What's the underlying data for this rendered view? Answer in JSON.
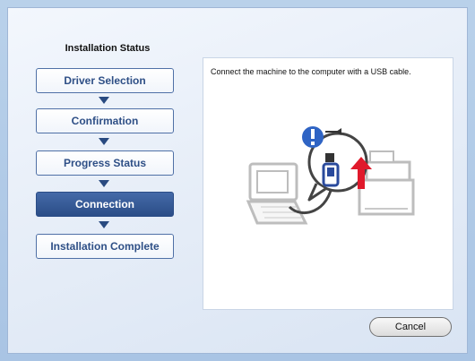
{
  "sidebar": {
    "title": "Installation Status",
    "steps": [
      {
        "label": "Driver Selection",
        "state": "inactive"
      },
      {
        "label": "Confirmation",
        "state": "inactive"
      },
      {
        "label": "Progress Status",
        "state": "inactive"
      },
      {
        "label": "Connection",
        "state": "active"
      },
      {
        "label": "Installation Complete",
        "state": "inactive"
      }
    ]
  },
  "main": {
    "message": "Connect the machine to the computer with a USB cable.",
    "illustration_icons": [
      "alert-icon",
      "usb-icon",
      "up-arrow-icon",
      "laptop-icon",
      "printer-icon"
    ]
  },
  "footer": {
    "cancel_label": "Cancel"
  },
  "colors": {
    "accent": "#2e4f86",
    "active_step": "#2b4d87",
    "alert_blue": "#2f64c4",
    "arrow_red": "#e0192b"
  }
}
